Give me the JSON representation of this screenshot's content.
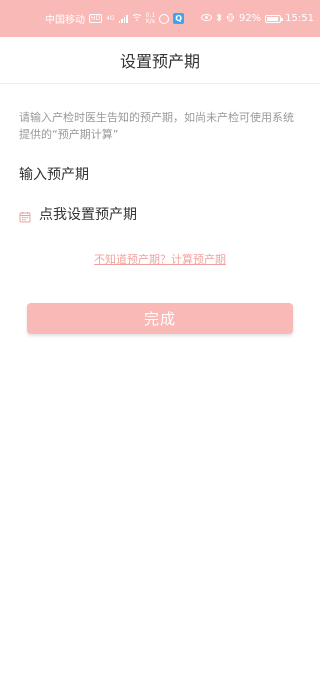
{
  "status_bar": {
    "carrier": "中国移动",
    "hd_badge": "HD",
    "network_badge": "4G",
    "speed_top": "0.1",
    "speed_bottom": "K/s",
    "battery_percent": "92%",
    "time": "15:51"
  },
  "header": {
    "title": "设置预产期"
  },
  "main": {
    "description": "请输入产检时医生告知的预产期，如尚未产检可使用系统 提供的“预产期计算”",
    "section_label": "输入预产期",
    "date_placeholder": "点我设置预产期",
    "calc_link": "不知道预产期？计算预产期",
    "done_button": "完成"
  },
  "colors": {
    "accent": "#f9b9b7",
    "link": "#f2a3a0",
    "text_primary": "#333333",
    "text_secondary": "#999999"
  },
  "icons": {
    "date_field": "calendar-icon"
  }
}
